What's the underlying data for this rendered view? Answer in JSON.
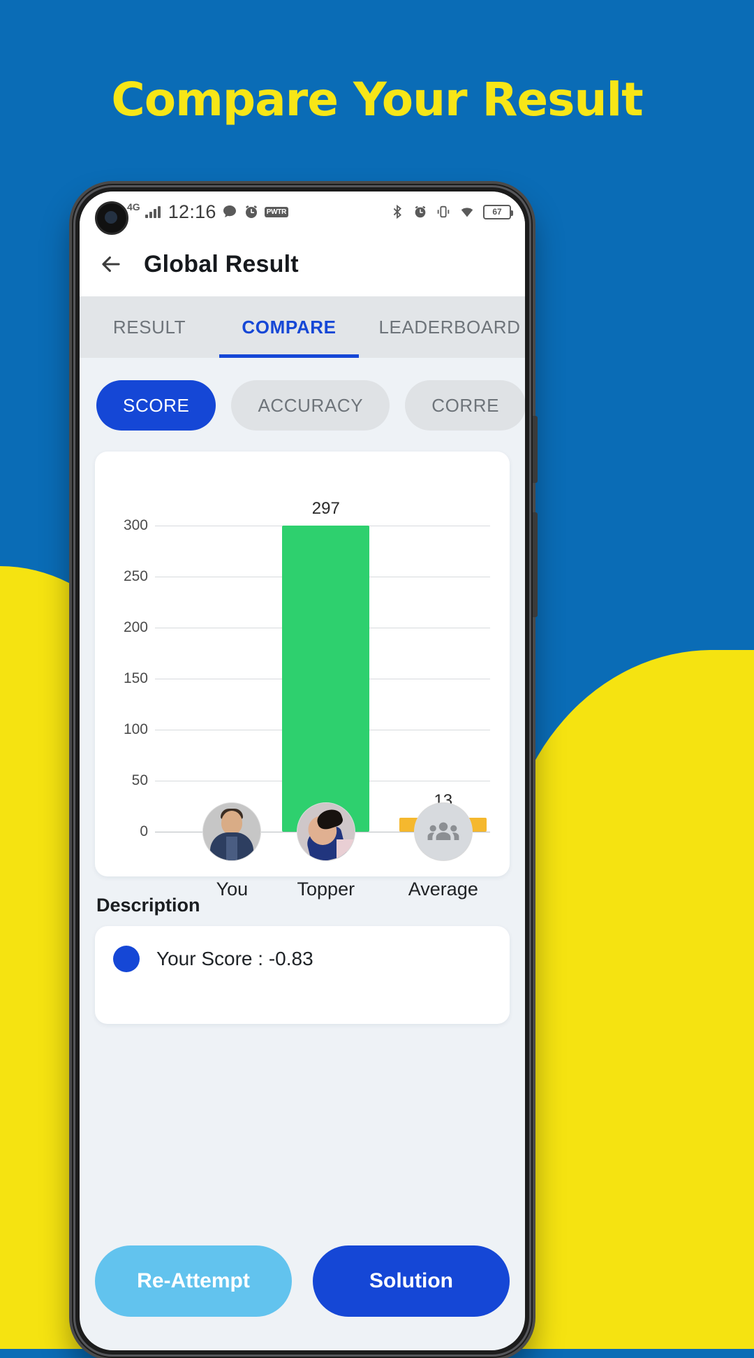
{
  "promo": {
    "title": "Compare Your Result",
    "bg_color": "#0a6cb6",
    "title_color": "#f7e617",
    "accent_color": "#f5e311"
  },
  "status_bar": {
    "network": "4G",
    "time": "12:16",
    "left_icons": [
      "signal-bars-icon",
      "chat-bubble-icon",
      "alarm-clock-icon",
      "pwtr-badge-icon"
    ],
    "pwtr_label": "PWTR",
    "right_icons": [
      "bluetooth-icon",
      "alarm-clock-icon",
      "vibrate-icon",
      "wifi-icon"
    ],
    "battery_level": "67"
  },
  "app_bar": {
    "back_icon": "arrow-left-icon",
    "title": "Global Result"
  },
  "tabs": {
    "items": [
      {
        "label": "RESULT",
        "active": false
      },
      {
        "label": "COMPARE",
        "active": true
      },
      {
        "label": "LEADERBOARD",
        "active": false
      }
    ],
    "active_color": "#1547d6",
    "inactive_color": "#6e747a"
  },
  "chips": {
    "items": [
      {
        "label": "SCORE",
        "active": true
      },
      {
        "label": "ACCURACY",
        "active": false
      },
      {
        "label": "CORRE",
        "active": false
      }
    ],
    "active_bg": "#1547d6",
    "inactive_bg": "#dfe2e5"
  },
  "chart_data": {
    "type": "bar",
    "title": "",
    "xlabel": "",
    "ylabel": "",
    "categories": [
      "You",
      "Topper",
      "Average"
    ],
    "values": [
      0,
      297,
      13
    ],
    "value_labels": [
      "",
      "297",
      "13"
    ],
    "colors": [
      "#2f5fd0",
      "#2ed06e",
      "#f5b82e"
    ],
    "yticks": [
      0,
      50,
      100,
      150,
      200,
      250,
      300
    ],
    "ylim": [
      0,
      320
    ],
    "grid": true,
    "legend": "none",
    "avatars": [
      "you-avatar",
      "topper-avatar",
      "average-group-avatar"
    ]
  },
  "description": {
    "heading": "Description",
    "items": [
      {
        "dot_color": "#1547d6",
        "text": "Your Score : -0.83"
      }
    ]
  },
  "actions": {
    "reattempt_label": "Re-Attempt",
    "reattempt_color": "#62c3ee",
    "solution_label": "Solution",
    "solution_color": "#1547d6"
  }
}
